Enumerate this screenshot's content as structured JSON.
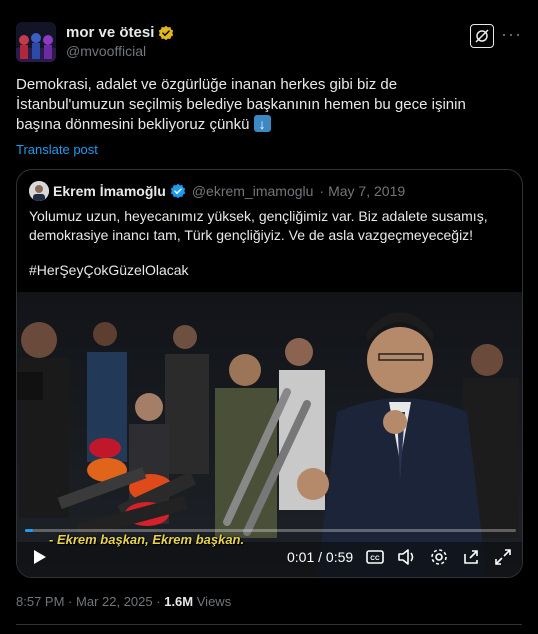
{
  "tweet": {
    "display_name": "mor ve ötesi",
    "handle": "@mvoofficial",
    "verified_badge_color": "#e2b719",
    "text": "Demokrasi, adalet ve özgürlüğe inanan herkes gibi biz de\nİstanbul'umuzun seçilmiş belediye başkanının hemen bu gece işinin\nbaşına dönmesini bekliyoruz çünkü",
    "emoji": "down-arrow-emoji",
    "translate_label": "Translate post",
    "icons": {
      "grok": "grok-icon",
      "more": "more-icon"
    }
  },
  "quote": {
    "display_name": "Ekrem İmamoğlu",
    "handle": "@ekrem_imamoglu",
    "separator": "·",
    "date": "May 7, 2019",
    "verified_badge_color": "#1d9bf0",
    "text": "Yolumuz uzun, heyecanımız yüksek, gençliğimiz var. Biz adalete susamış, demokrasiye inancı tam, Türk gençliğiyiz. Ve de asla vazgeçmeyeceğiz!",
    "hashtag": "#HerŞeyÇokGüzelOlacak",
    "video": {
      "subtitle": "- Ekrem başkan, Ekrem başkan.",
      "current_time": "0:01",
      "duration": "0:59",
      "time_display": "0:01 / 0:59",
      "progress_fraction": 0.017,
      "controls": [
        "play-icon",
        "captions-icon",
        "volume-icon",
        "settings-icon",
        "share-icon",
        "fullscreen-icon"
      ]
    }
  },
  "footer": {
    "time": "8:57 PM",
    "separator": "·",
    "date": "Mar 22, 2025",
    "views_count": "1.6M",
    "views_label": "Views"
  },
  "colors": {
    "background": "#000000",
    "text": "#e7e9ea",
    "muted": "#71767b",
    "link": "#1d9bf0",
    "border": "#2f3336",
    "subtitle": "#e8d34a"
  }
}
